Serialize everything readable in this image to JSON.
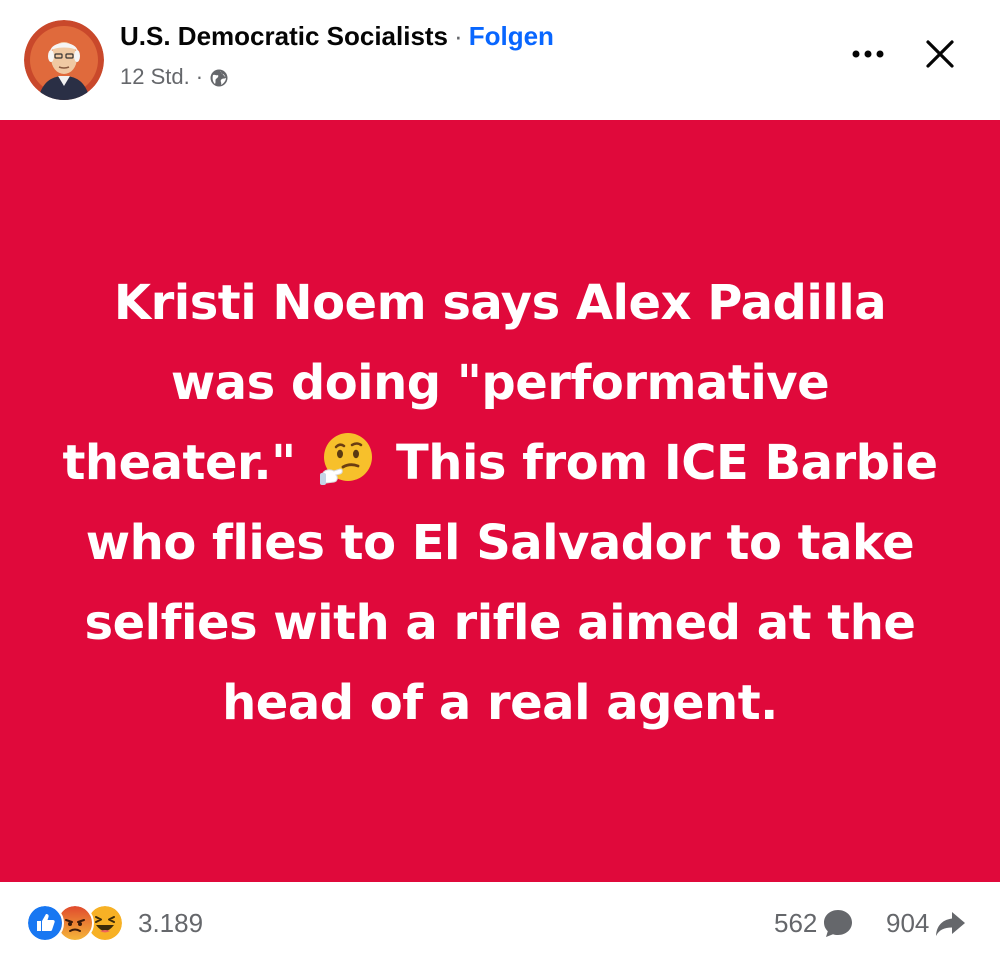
{
  "post": {
    "page_name": "U.S. Democratic Socialists",
    "separator": "·",
    "follow_label": "Folgen",
    "timestamp": "12 Std.",
    "meta_separator": "·",
    "audience_icon": "globe-icon",
    "more_icon": "more-options-icon",
    "close_icon": "close-icon",
    "avatar_icon": "page-avatar"
  },
  "text_card": {
    "background_color": "#e0093b",
    "text_before_emoji": "Kristi Noem says Alex Padilla was doing \"performative theater.\"",
    "emoji": "thinking-face-emoji",
    "text_after_emoji": "This from ICE Barbie who flies to El Salvador to take selfies with a rifle aimed at the head of a real agent."
  },
  "footer": {
    "reaction_icons": [
      "like-reaction-icon",
      "angry-reaction-icon",
      "haha-reaction-icon"
    ],
    "reaction_count": "3.189",
    "comment_count": "562",
    "comment_icon": "comment-icon",
    "share_count": "904",
    "share_icon": "share-icon"
  },
  "colors": {
    "link_blue": "#0866ff",
    "secondary_text": "#65676b",
    "like_blue": "#1877f2",
    "angry_red": "#e9710f",
    "haha_yellow": "#f7b125"
  }
}
